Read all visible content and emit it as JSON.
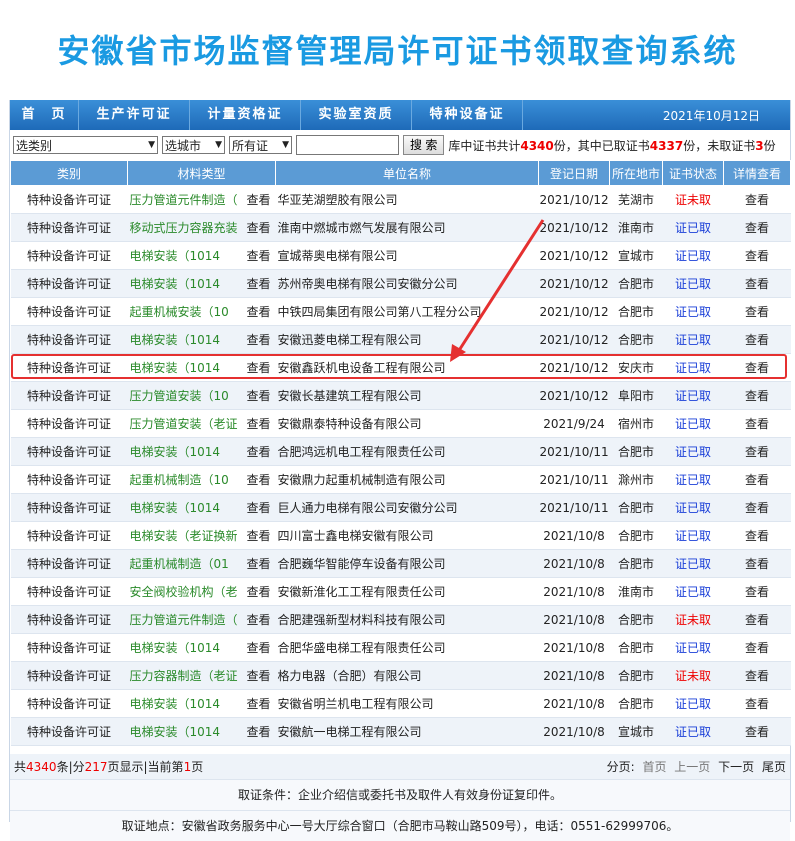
{
  "title": "安徽省市场监督管理局许可证书领取查询系统",
  "nav": {
    "items": [
      "首　页",
      "生产许可证",
      "计量资格证",
      "实验室资质",
      "特种设备证"
    ],
    "date": "2021年10月12日"
  },
  "filters": {
    "category": "选类别",
    "city": "选城市",
    "cert": "所有证",
    "search_placeholder": "",
    "search_button": "搜 索",
    "stats_prefix": "库中证书共计",
    "total": "4340",
    "stats_mid1": "份，其中已取证书",
    "taken": "4337",
    "stats_mid2": "份，未取证书",
    "untaken": "3",
    "stats_suffix": "份"
  },
  "table": {
    "headers": [
      "类别",
      "材料类型",
      "单位名称",
      "登记日期",
      "所在地市",
      "证书状态",
      "详情查看"
    ],
    "rows": [
      {
        "cat": "特种设备许可证",
        "mat": "压力管道元件制造（",
        "view_mat": "查看",
        "unit": "华亚芜湖塑胶有限公司",
        "date": "2021/10/12",
        "city": "芜湖市",
        "status": "证未取",
        "detail": "查看"
      },
      {
        "cat": "特种设备许可证",
        "mat": "移动式压力容器充装",
        "view_mat": "查看",
        "unit": "淮南中燃城市燃气发展有限公司",
        "date": "2021/10/12",
        "city": "淮南市",
        "status": "证已取",
        "detail": "查看"
      },
      {
        "cat": "特种设备许可证",
        "mat": "电梯安装（1014",
        "view_mat": "查看",
        "unit": "宣城蒂奥电梯有限公司",
        "date": "2021/10/12",
        "city": "宣城市",
        "status": "证已取",
        "detail": "查看"
      },
      {
        "cat": "特种设备许可证",
        "mat": "电梯安装（1014",
        "view_mat": "查看",
        "unit": "苏州帝奥电梯有限公司安徽分公司",
        "date": "2021/10/12",
        "city": "合肥市",
        "status": "证已取",
        "detail": "查看"
      },
      {
        "cat": "特种设备许可证",
        "mat": "起重机械安装（10",
        "view_mat": "查看",
        "unit": "中铁四局集团有限公司第八工程分公司",
        "date": "2021/10/12",
        "city": "合肥市",
        "status": "证已取",
        "detail": "查看"
      },
      {
        "cat": "特种设备许可证",
        "mat": "电梯安装（1014",
        "view_mat": "查看",
        "unit": "安徽迅菱电梯工程有限公司",
        "date": "2021/10/12",
        "city": "合肥市",
        "status": "证已取",
        "detail": "查看"
      },
      {
        "cat": "特种设备许可证",
        "mat": "电梯安装（1014",
        "view_mat": "查看",
        "unit": "安徽鑫跃机电设备工程有限公司",
        "date": "2021/10/12",
        "city": "安庆市",
        "status": "证已取",
        "detail": "查看"
      },
      {
        "cat": "特种设备许可证",
        "mat": "压力管道安装（10",
        "view_mat": "查看",
        "unit": "安徽长基建筑工程有限公司",
        "date": "2021/10/12",
        "city": "阜阳市",
        "status": "证已取",
        "detail": "查看"
      },
      {
        "cat": "特种设备许可证",
        "mat": "压力管道安装（老证",
        "view_mat": "查看",
        "unit": "安徽鼎泰特种设备有限公司",
        "date": "2021/9/24",
        "city": "宿州市",
        "status": "证已取",
        "detail": "查看"
      },
      {
        "cat": "特种设备许可证",
        "mat": "电梯安装（1014",
        "view_mat": "查看",
        "unit": "合肥鸿远机电工程有限责任公司",
        "date": "2021/10/11",
        "city": "合肥市",
        "status": "证已取",
        "detail": "查看"
      },
      {
        "cat": "特种设备许可证",
        "mat": "起重机械制造（10",
        "view_mat": "查看",
        "unit": "安徽鼎力起重机械制造有限公司",
        "date": "2021/10/11",
        "city": "滁州市",
        "status": "证已取",
        "detail": "查看"
      },
      {
        "cat": "特种设备许可证",
        "mat": "电梯安装（1014",
        "view_mat": "查看",
        "unit": "巨人通力电梯有限公司安徽分公司",
        "date": "2021/10/11",
        "city": "合肥市",
        "status": "证已取",
        "detail": "查看"
      },
      {
        "cat": "特种设备许可证",
        "mat": "电梯安装（老证换新",
        "view_mat": "查看",
        "unit": "四川富士鑫电梯安徽有限公司",
        "date": "2021/10/8",
        "city": "合肥市",
        "status": "证已取",
        "detail": "查看"
      },
      {
        "cat": "特种设备许可证",
        "mat": "起重机械制造（01",
        "view_mat": "查看",
        "unit": "合肥巍华智能停车设备有限公司",
        "date": "2021/10/8",
        "city": "合肥市",
        "status": "证已取",
        "detail": "查看"
      },
      {
        "cat": "特种设备许可证",
        "mat": "安全阀校验机构（老",
        "view_mat": "查看",
        "unit": "安徽新淮化工工程有限责任公司",
        "date": "2021/10/8",
        "city": "淮南市",
        "status": "证已取",
        "detail": "查看"
      },
      {
        "cat": "特种设备许可证",
        "mat": "压力管道元件制造（",
        "view_mat": "查看",
        "unit": "合肥建强新型材料科技有限公司",
        "date": "2021/10/8",
        "city": "合肥市",
        "status": "证未取",
        "detail": "查看"
      },
      {
        "cat": "特种设备许可证",
        "mat": "电梯安装（1014",
        "view_mat": "查看",
        "unit": "合肥华盛电梯工程有限责任公司",
        "date": "2021/10/8",
        "city": "合肥市",
        "status": "证已取",
        "detail": "查看"
      },
      {
        "cat": "特种设备许可证",
        "mat": "压力容器制造（老证",
        "view_mat": "查看",
        "unit": "格力电器（合肥）有限公司",
        "date": "2021/10/8",
        "city": "合肥市",
        "status": "证未取",
        "detail": "查看"
      },
      {
        "cat": "特种设备许可证",
        "mat": "电梯安装（1014",
        "view_mat": "查看",
        "unit": "安徽省明兰机电工程有限公司",
        "date": "2021/10/8",
        "city": "合肥市",
        "status": "证已取",
        "detail": "查看"
      },
      {
        "cat": "特种设备许可证",
        "mat": "电梯安装（1014",
        "view_mat": "查看",
        "unit": "安徽航一电梯工程有限公司",
        "date": "2021/10/8",
        "city": "宣城市",
        "status": "证已取",
        "detail": "查看"
      }
    ]
  },
  "pager": {
    "total_prefix": "共",
    "total": "4340",
    "mid1": "条|分",
    "pages": "217",
    "mid2": "页显示|当前第",
    "current": "1",
    "suffix": "页",
    "label": "分页:",
    "first": "首页",
    "prev": "上一页",
    "next": "下一页",
    "last": "尾页"
  },
  "footer": {
    "condition": "取证条件：企业介绍信或委托书及取件人有效身份证复印件。",
    "address": "取证地点：安徽省政务服务中心一号大厅综合窗口（合肥市马鞍山路509号），电话：0551-62999706。"
  },
  "colors": {
    "accent": "#1a9ae2",
    "nav": "#1e6ab8",
    "highlight": "#e53030",
    "taken": "#1a3fd8",
    "untaken": "#e00000"
  },
  "highlighted_row": 6
}
